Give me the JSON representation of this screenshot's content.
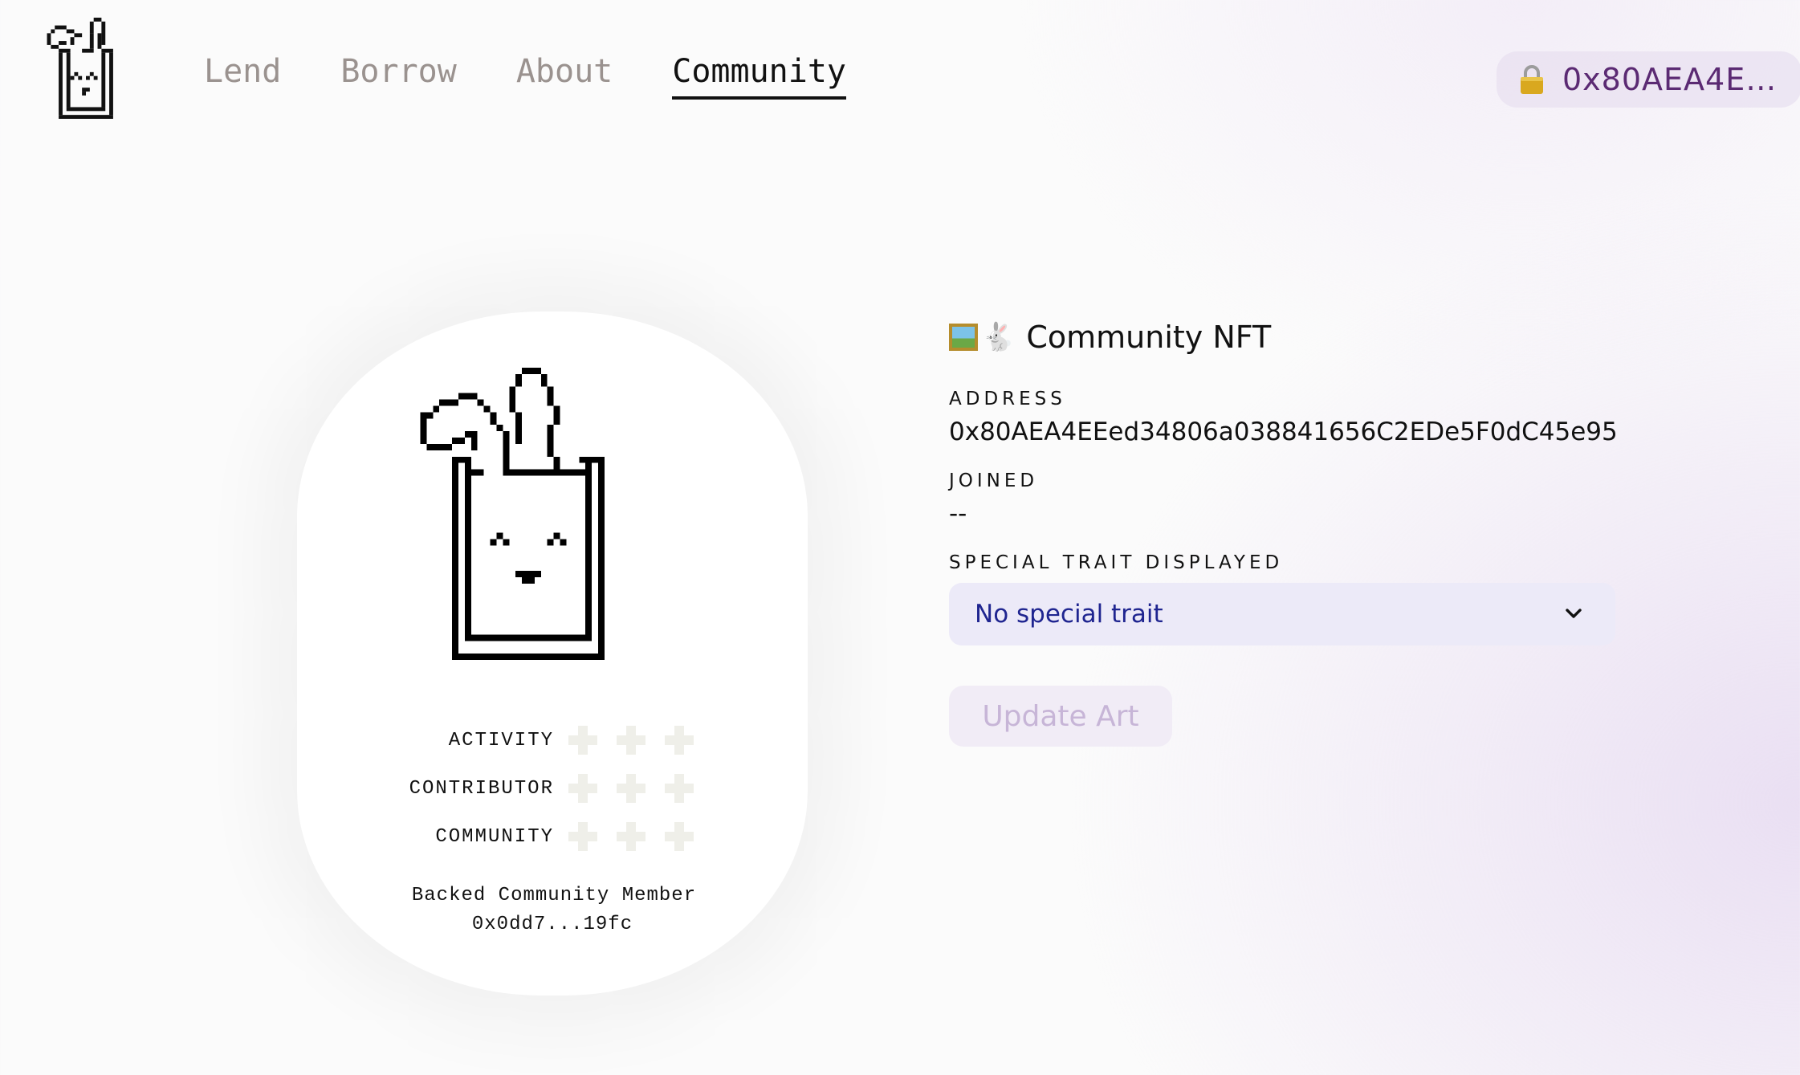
{
  "header": {
    "logo_icon": "bunny-logo-icon",
    "nav": [
      {
        "label": "Lend",
        "active": false
      },
      {
        "label": "Borrow",
        "active": false
      },
      {
        "label": "About",
        "active": false
      },
      {
        "label": "Community",
        "active": true
      }
    ],
    "wallet": {
      "icon": "lock-icon",
      "label": "0x80AEA4E…"
    }
  },
  "card": {
    "art_icon": "bunny-pixel-art",
    "traits": [
      {
        "label": "ACTIVITY",
        "count": 0,
        "max": 3
      },
      {
        "label": "CONTRIBUTOR",
        "count": 0,
        "max": 3
      },
      {
        "label": "COMMUNITY",
        "count": 0,
        "max": 3
      }
    ],
    "member_title": "Backed Community Member",
    "member_address": "0x0dd7...19fc"
  },
  "panel": {
    "title": "Community NFT",
    "title_icons": [
      "framed-picture-icon",
      "rabbit-icon"
    ],
    "address_label": "ADDRESS",
    "address_value": "0x80AEA4EEed34806a038841656C2EDe5F0dC45e95",
    "joined_label": "JOINED",
    "joined_value": "--",
    "trait_label": "SPECIAL TRAIT DISPLAYED",
    "trait_selected": "No special trait",
    "update_button": "Update Art"
  },
  "colors": {
    "accent_purple": "#5b2a73",
    "select_bg": "#eceaf8",
    "select_text": "#1f2590",
    "disabled_button_text": "#c7b5d7"
  }
}
